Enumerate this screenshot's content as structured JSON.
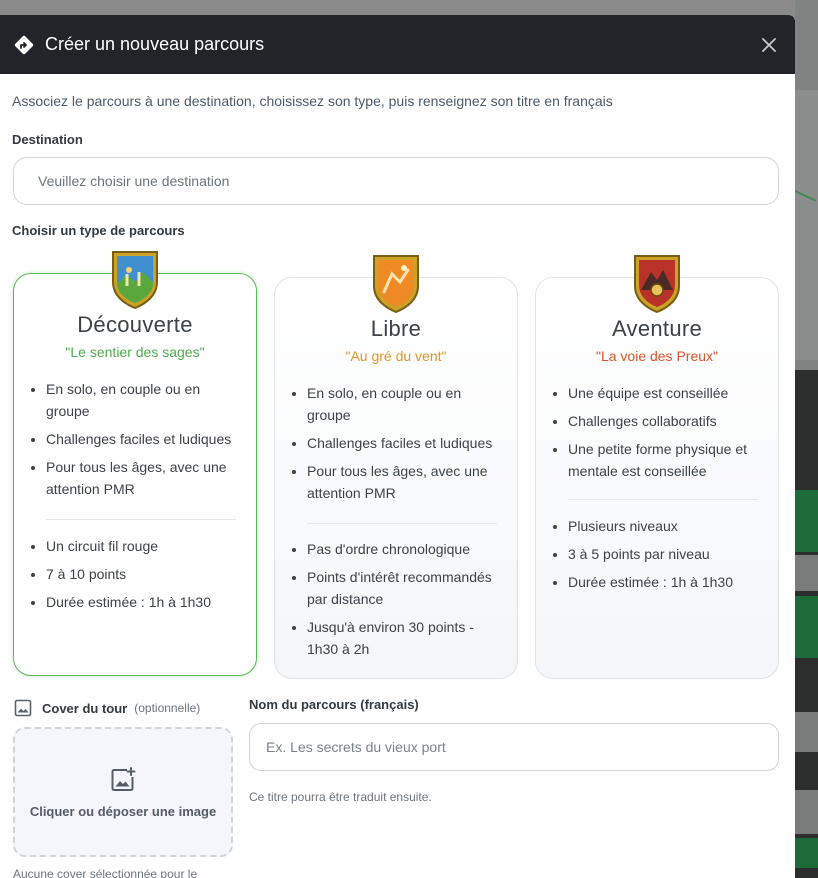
{
  "modal": {
    "title": "Créer un nouveau parcours",
    "intro": "Associez le parcours à une destination, choisissez son type, puis renseignez son titre en français"
  },
  "destination": {
    "label": "Destination",
    "placeholder": "Veuillez choisir une destination"
  },
  "type_section": {
    "label": "Choisir un type de parcours",
    "selected": "Découverte",
    "cards": [
      {
        "title": "Découverte",
        "subtitle": "\"Le sentier des sages\"",
        "subtitle_color": "#4cae4c",
        "features_a": [
          "En solo, en couple ou en groupe",
          "Challenges faciles et ludiques",
          "Pour tous les âges, avec une attention PMR"
        ],
        "features_b": [
          "Un circuit fil rouge",
          "7 à 10 points",
          "Durée estimée : 1h à 1h30"
        ]
      },
      {
        "title": "Libre",
        "subtitle": "\"Au gré du vent\"",
        "subtitle_color": "#e0952a",
        "features_a": [
          "En solo, en couple ou en groupe",
          "Challenges faciles et ludiques",
          "Pour tous les âges, avec une attention PMR"
        ],
        "features_b": [
          "Pas d'ordre chronologique",
          "Points d'intérêt recommandés par distance",
          "Jusqu'à environ 30 points - 1h30 à 2h"
        ]
      },
      {
        "title": "Aventure",
        "subtitle": "\"La voie des Preux\"",
        "subtitle_color": "#d9532b",
        "features_a": [
          "Une équipe est conseillée",
          "Challenges collaboratifs",
          "Une petite forme physique et mentale est conseillée"
        ],
        "features_b": [
          "Plusieurs niveaux",
          "3 à 5 points par niveau",
          "Durée estimée : 1h à 1h30"
        ]
      }
    ]
  },
  "cover": {
    "label": "Cover du tour",
    "optional": "(optionnelle)",
    "dropzone_text": "Cliquer ou déposer une image",
    "status": "Aucune cover sélectionnée pour le"
  },
  "tour_name": {
    "label": "Nom du parcours (français)",
    "placeholder": "Ex. Les secrets du vieux port",
    "value": "",
    "hint": "Ce titre pourra être traduit ensuite."
  }
}
